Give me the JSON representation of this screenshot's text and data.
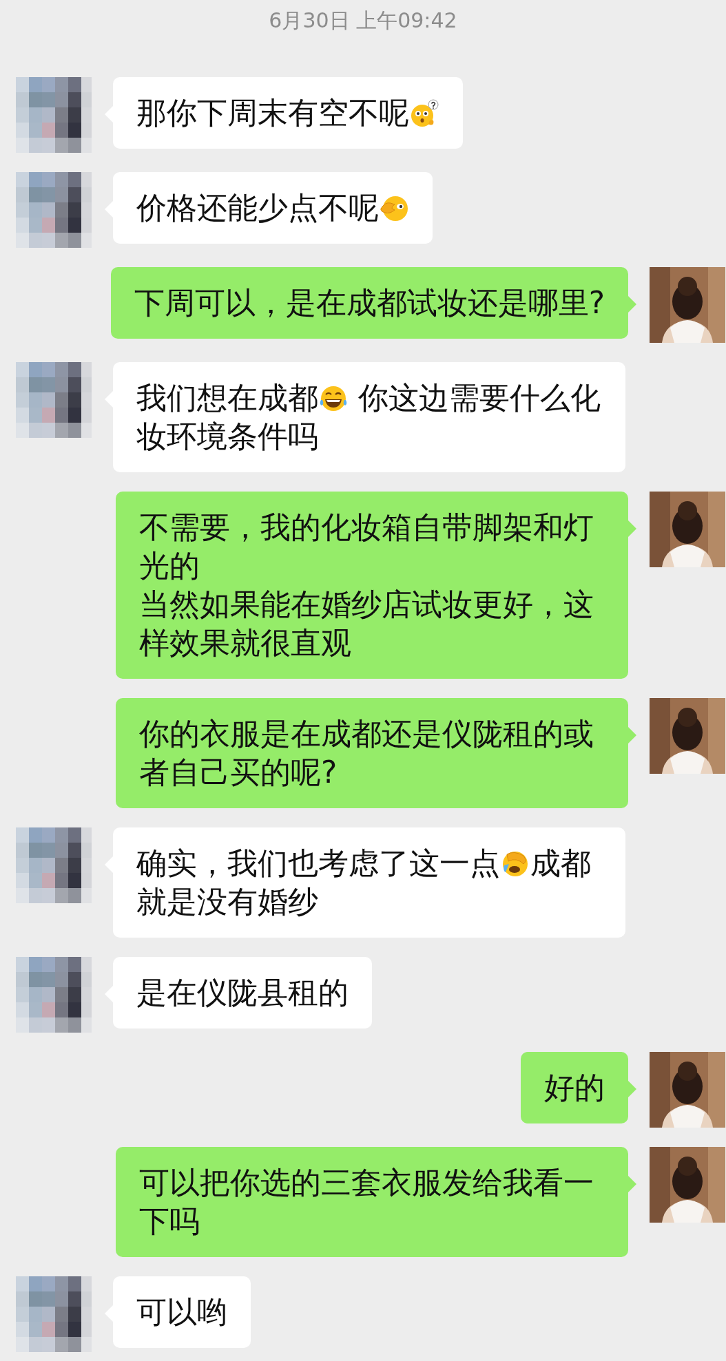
{
  "timestamp": "6月30日 上午09:42",
  "messages": [
    {
      "kind": "received",
      "lines": [
        [
          {
            "kind": "text",
            "text": "那你下周末有空不呢"
          },
          {
            "kind": "puzzled"
          }
        ]
      ]
    },
    {
      "kind": "received",
      "lines": [
        [
          {
            "kind": "text",
            "text": "价格还能少点不呢"
          },
          {
            "kind": "peeking"
          }
        ]
      ]
    },
    {
      "kind": "sent",
      "lines": [
        [
          {
            "kind": "text",
            "text": "下周可以，是在成都试妆还是哪里?"
          }
        ]
      ]
    },
    {
      "kind": "received",
      "lines": [
        [
          {
            "kind": "text",
            "text": "我们想在成都"
          },
          {
            "kind": "laughing"
          },
          {
            "kind": "text",
            "text": " 你这边需要什么化"
          }
        ],
        [
          {
            "kind": "text",
            "text": "妆环境条件吗"
          }
        ]
      ]
    },
    {
      "kind": "sent",
      "lines": [
        [
          {
            "kind": "text",
            "text": "不需要，我的化妆箱自带脚架和灯"
          }
        ],
        [
          {
            "kind": "text",
            "text": "光的"
          }
        ],
        [
          {
            "kind": "text",
            "text": "当然如果能在婚纱店试妆更好，这"
          }
        ],
        [
          {
            "kind": "text",
            "text": "样效果就很直观"
          }
        ]
      ]
    },
    {
      "kind": "sent",
      "lines": [
        [
          {
            "kind": "text",
            "text": "你的衣服是在成都还是仪陇租的或"
          }
        ],
        [
          {
            "kind": "text",
            "text": "者自己买的呢?"
          }
        ]
      ]
    },
    {
      "kind": "received",
      "lines": [
        [
          {
            "kind": "text",
            "text": "确实，我们也考虑了这一点"
          },
          {
            "kind": "crying"
          },
          {
            "kind": "text",
            "text": "成都"
          }
        ],
        [
          {
            "kind": "text",
            "text": "就是没有婚纱"
          }
        ]
      ]
    },
    {
      "kind": "received",
      "lines": [
        [
          {
            "kind": "text",
            "text": "是在仪陇县租的"
          }
        ]
      ]
    },
    {
      "kind": "sent",
      "lines": [
        [
          {
            "kind": "text",
            "text": "好的"
          }
        ]
      ]
    },
    {
      "kind": "sent",
      "lines": [
        [
          {
            "kind": "text",
            "text": "可以把你选的三套衣服发给我看一"
          }
        ],
        [
          {
            "kind": "text",
            "text": "下吗"
          }
        ]
      ]
    },
    {
      "kind": "received",
      "lines": [
        [
          {
            "kind": "text",
            "text": "可以哟"
          }
        ]
      ]
    }
  ]
}
